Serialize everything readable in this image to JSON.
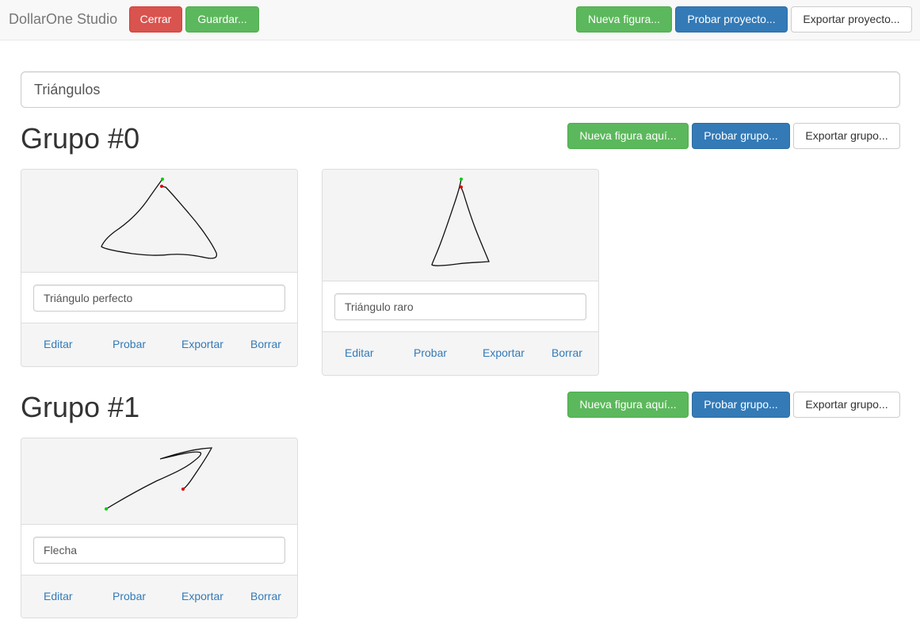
{
  "navbar": {
    "brand": "DollarOne Studio",
    "close_label": "Cerrar",
    "save_label": "Guardar...",
    "new_figure_label": "Nueva figura...",
    "test_project_label": "Probar proyecto...",
    "export_project_label": "Exportar proyecto..."
  },
  "project": {
    "name": "Triángulos"
  },
  "groups": [
    {
      "title": "Grupo #0",
      "new_here_label": "Nueva figura aquí...",
      "test_group_label": "Probar grupo...",
      "export_group_label": "Exportar grupo...",
      "figures": [
        {
          "name": "Triángulo perfecto",
          "edit": "Editar",
          "test": "Probar",
          "export": "Exportar",
          "delete": "Borrar"
        },
        {
          "name": "Triángulo raro",
          "edit": "Editar",
          "test": "Probar",
          "export": "Exportar",
          "delete": "Borrar"
        }
      ]
    },
    {
      "title": "Grupo #1",
      "new_here_label": "Nueva figura aquí...",
      "test_group_label": "Probar grupo...",
      "export_group_label": "Exportar grupo...",
      "figures": [
        {
          "name": "Flecha",
          "edit": "Editar",
          "test": "Probar",
          "export": "Exportar",
          "delete": "Borrar"
        }
      ]
    }
  ],
  "colors": {
    "danger": "#d9534f",
    "success": "#5cb85c",
    "primary": "#337ab7",
    "link": "#337ab7",
    "stroke_start": "#00cc00",
    "stroke_end": "#dd0000"
  }
}
